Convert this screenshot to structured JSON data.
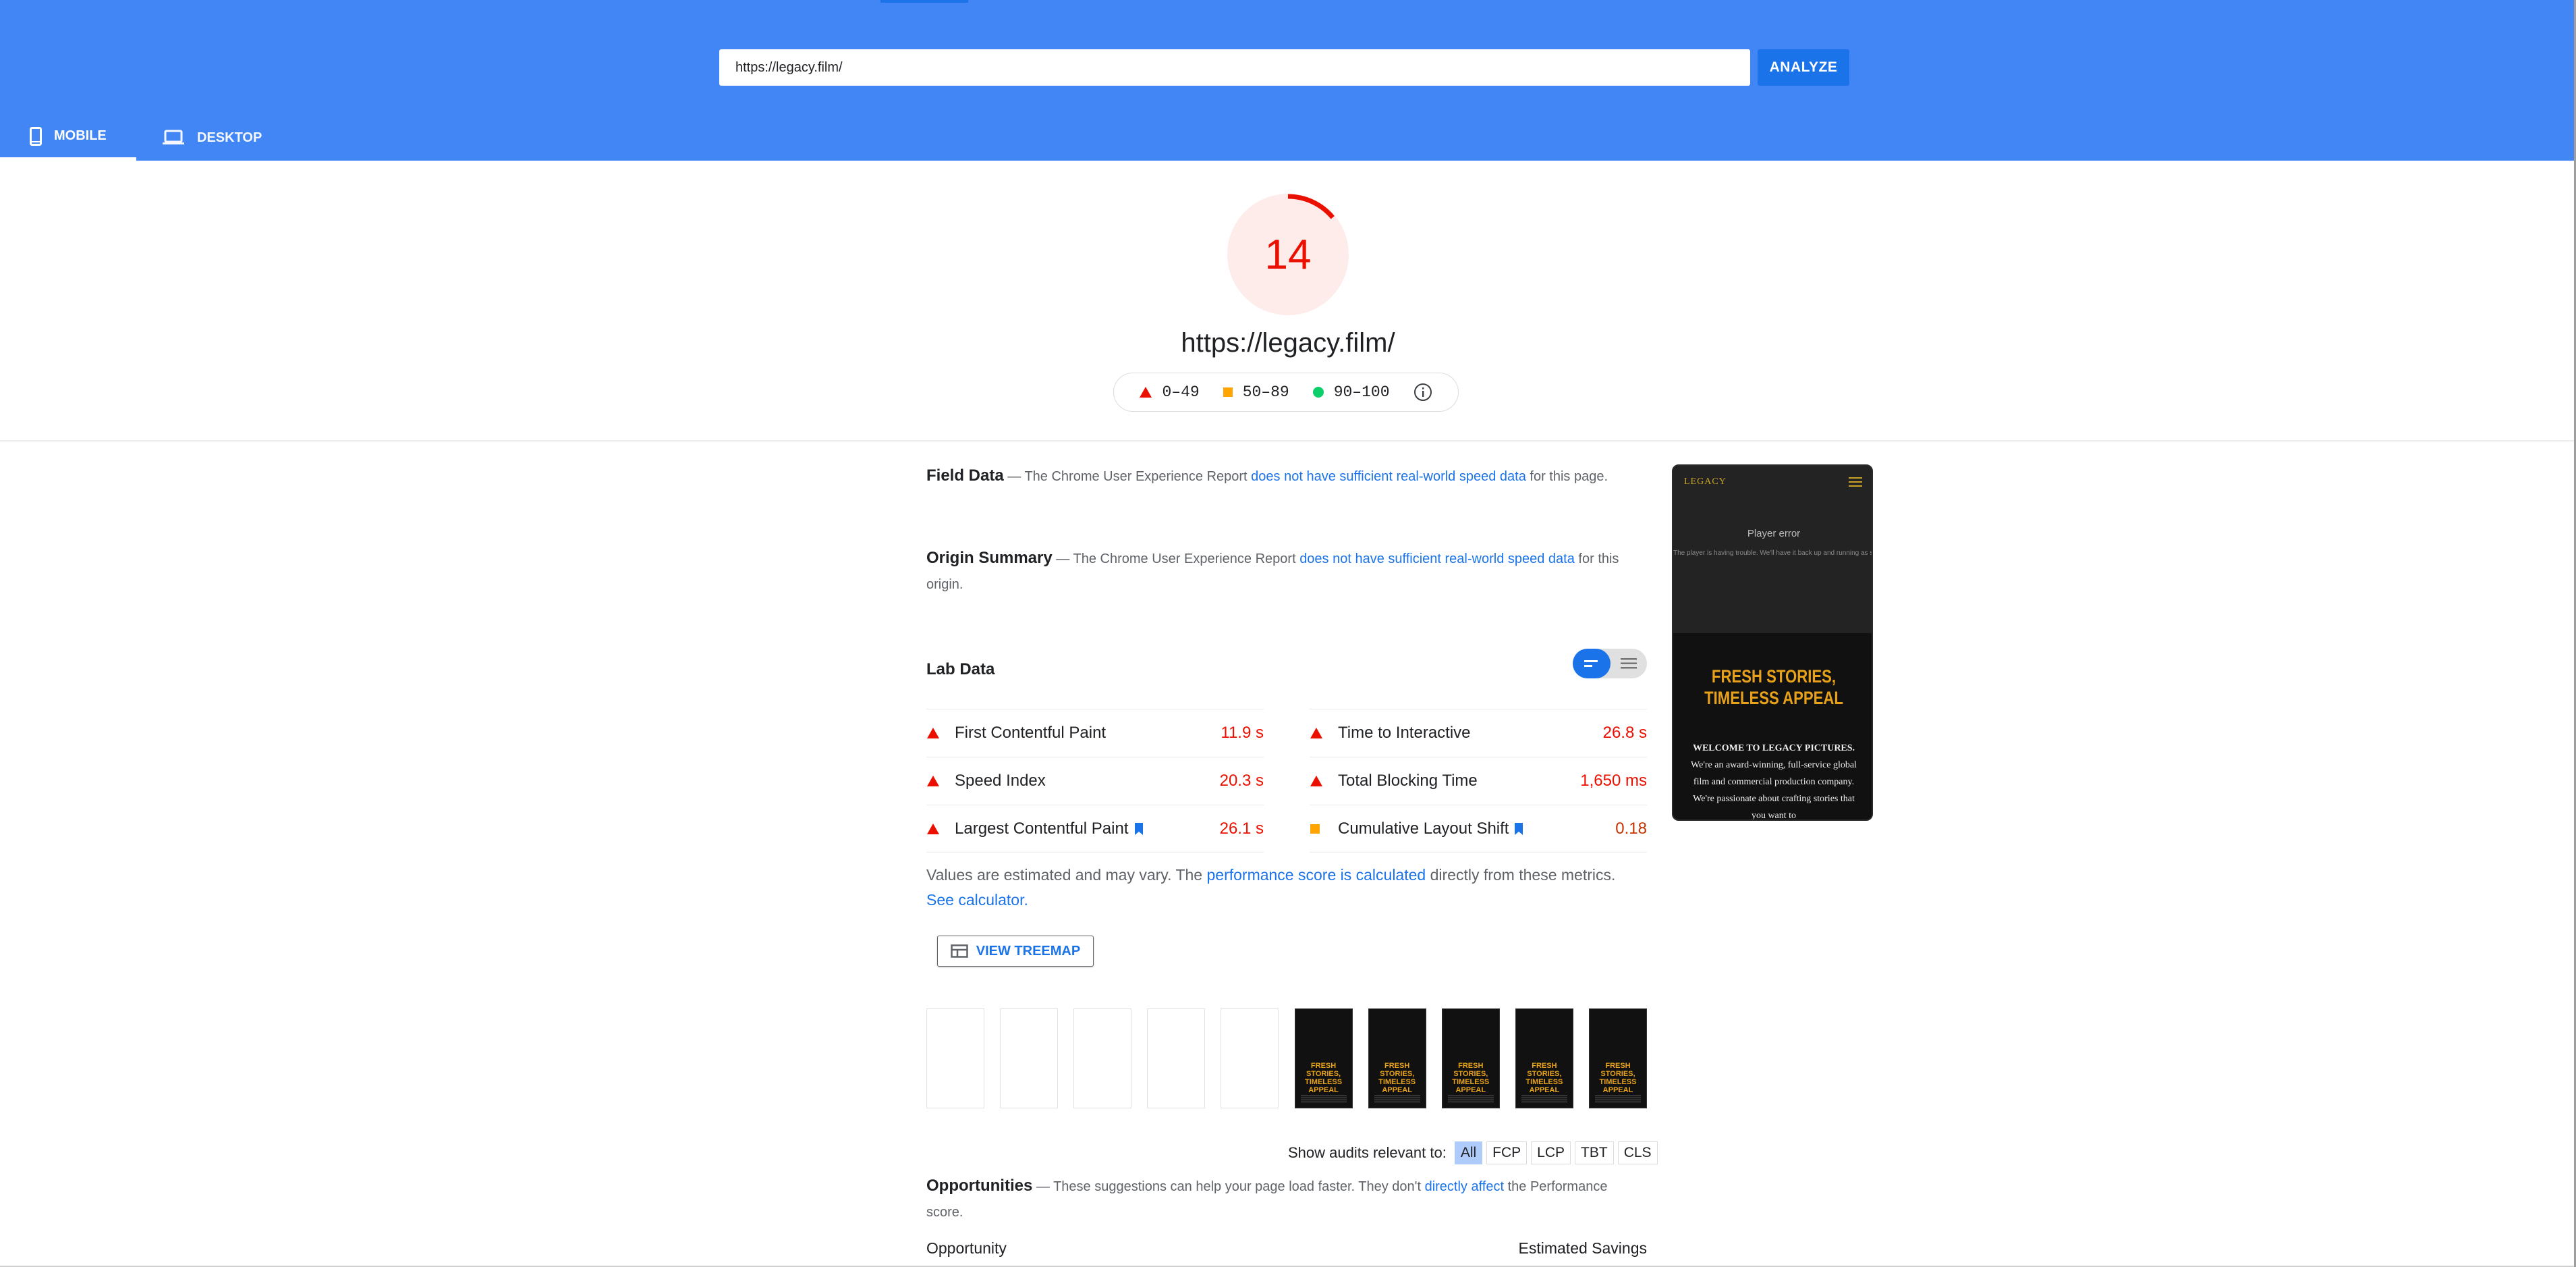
{
  "search": {
    "url_value": "https://legacy.film/",
    "analyze_label": "ANALYZE"
  },
  "tabs": {
    "mobile": "MOBILE",
    "desktop": "DESKTOP"
  },
  "score": {
    "value": "14",
    "fraction": 0.14,
    "url": "https://legacy.film/"
  },
  "legend": {
    "fail": "0–49",
    "average": "50–89",
    "pass": "90–100"
  },
  "field_data": {
    "title": "Field Data",
    "dash": " — ",
    "pre": "The Chrome User Experience Report ",
    "link": "does not have sufficient real-world speed data",
    "post": " for this page."
  },
  "origin_summary": {
    "title": "Origin Summary",
    "dash": " — ",
    "pre": "The Chrome User Experience Report ",
    "link": "does not have sufficient real-world speed data",
    "post": " for this origin."
  },
  "lab_data": {
    "title": "Lab Data",
    "metrics": [
      {
        "name": "First Contentful Paint",
        "value": "11.9 s",
        "status": "fail"
      },
      {
        "name": "Time to Interactive",
        "value": "26.8 s",
        "status": "fail"
      },
      {
        "name": "Speed Index",
        "value": "20.3 s",
        "status": "fail"
      },
      {
        "name": "Total Blocking Time",
        "value": "1,650 ms",
        "status": "fail"
      },
      {
        "name": "Largest Contentful Paint",
        "value": "26.1 s",
        "status": "fail"
      },
      {
        "name": "Cumulative Layout Shift",
        "value": "0.18",
        "status": "average"
      }
    ],
    "note_pre": "Values are estimated and may vary. The ",
    "note_link": "performance score is calculated",
    "note_mid": " directly from these metrics. ",
    "note_calc": "See calculator.",
    "treemap": "VIEW TREEMAP"
  },
  "filmstrip": {
    "frame_title": "FRESH STORIES, TIMELESS APPEAL"
  },
  "audits_filter": {
    "label": "Show audits relevant to:",
    "chips": [
      "All",
      "FCP",
      "LCP",
      "TBT",
      "CLS"
    ]
  },
  "opportunities": {
    "title": "Opportunities",
    "dash": " — ",
    "pre": "These suggestions can help your page load faster. They don't ",
    "link": "directly affect",
    "post": " the Performance score.",
    "col_opportunity": "Opportunity",
    "col_savings": "Estimated Savings"
  },
  "phone_screenshot": {
    "logo": "LEGACY",
    "error_title": "Player error",
    "error_msg": "The player is having trouble. We'll have it back up and running as soon as possible.",
    "headline_1": "FRESH STORIES,",
    "headline_2": "TIMELESS APPEAL",
    "body_bold": "WELCOME TO LEGACY PICTURES.",
    "body": " We're an award-winning, full-service global film and commercial production company. We're passionate about crafting stories that you want to"
  },
  "colors": {
    "header": "#4285f4",
    "fail": "#eb0f00",
    "average": "#ffa400",
    "pass": "#0cce6b",
    "link": "#1a73e8"
  }
}
